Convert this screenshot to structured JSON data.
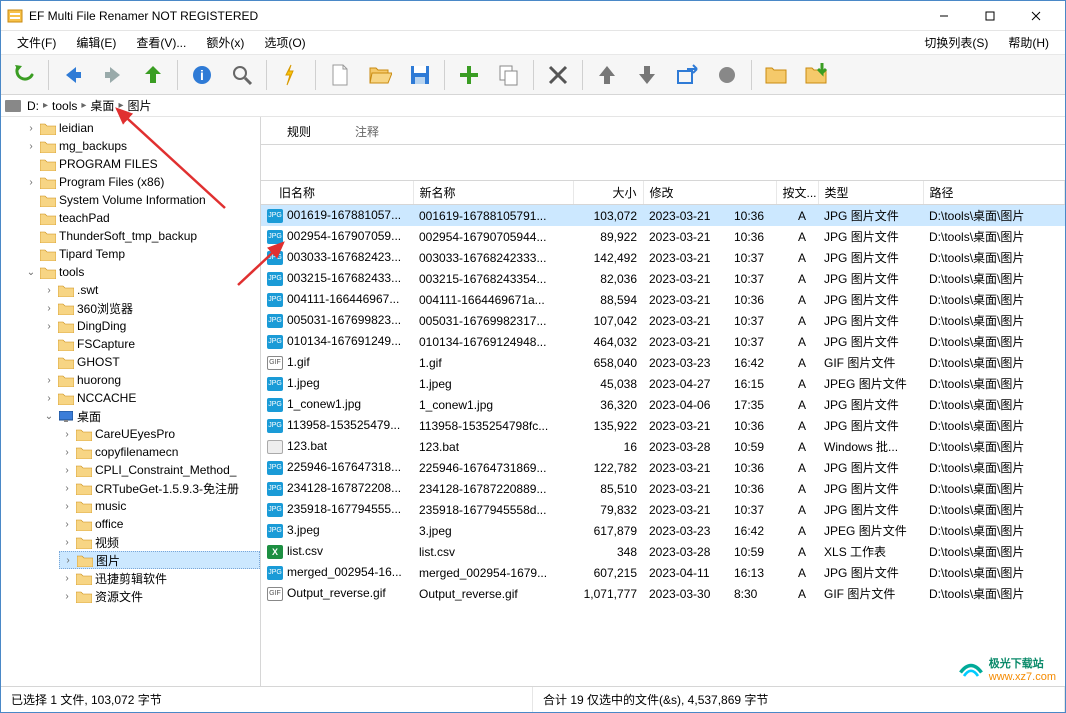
{
  "window": {
    "title": "EF Multi File Renamer NOT REGISTERED"
  },
  "menu": {
    "file": "文件(F)",
    "edit": "编辑(E)",
    "view": "查看(V)...",
    "extra": "额外(x)",
    "options": "选项(O)",
    "switch_list": "切换列表(S)",
    "help": "帮助(H)"
  },
  "breadcrumb": {
    "segs": [
      "D:",
      "tools",
      "桌面",
      "图片"
    ]
  },
  "tree": [
    {
      "l": "leidian",
      "d": 1,
      "e": "›"
    },
    {
      "l": "mg_backups",
      "d": 1,
      "e": "›"
    },
    {
      "l": "PROGRAM FILES",
      "d": 1,
      "e": ""
    },
    {
      "l": "Program Files (x86)",
      "d": 1,
      "e": "›"
    },
    {
      "l": "System Volume Information",
      "d": 1,
      "e": ""
    },
    {
      "l": "teachPad",
      "d": 1,
      "e": ""
    },
    {
      "l": "ThunderSoft_tmp_backup",
      "d": 1,
      "e": ""
    },
    {
      "l": "Tipard Temp",
      "d": 1,
      "e": ""
    },
    {
      "l": "tools",
      "d": 1,
      "e": "⌄"
    },
    {
      "l": ".swt",
      "d": 2,
      "e": "›"
    },
    {
      "l": "360浏览器",
      "d": 2,
      "e": "›"
    },
    {
      "l": "DingDing",
      "d": 2,
      "e": "›"
    },
    {
      "l": "FSCapture",
      "d": 2,
      "e": ""
    },
    {
      "l": "GHOST",
      "d": 2,
      "e": ""
    },
    {
      "l": "huorong",
      "d": 2,
      "e": "›"
    },
    {
      "l": "NCCACHE",
      "d": 2,
      "e": "›"
    },
    {
      "l": "桌面",
      "d": 2,
      "e": "⌄",
      "desk": true
    },
    {
      "l": "CareUEyesPro",
      "d": 3,
      "e": "›"
    },
    {
      "l": "copyfilenamecn",
      "d": 3,
      "e": "›"
    },
    {
      "l": "CPLI_Constraint_Method_",
      "d": 3,
      "e": "›"
    },
    {
      "l": "CRTubeGet-1.5.9.3-免注册",
      "d": 3,
      "e": "›"
    },
    {
      "l": "music",
      "d": 3,
      "e": "›"
    },
    {
      "l": "office",
      "d": 3,
      "e": "›"
    },
    {
      "l": "视频",
      "d": 3,
      "e": "›"
    },
    {
      "l": "图片",
      "d": 3,
      "e": "›",
      "sel": true
    },
    {
      "l": "迅捷剪辑软件",
      "d": 3,
      "e": "›"
    },
    {
      "l": "资源文件",
      "d": 3,
      "e": "›"
    }
  ],
  "tabs": {
    "rules": "规则",
    "comment": "注释"
  },
  "columns": {
    "old": "旧名称",
    "new": "新名称",
    "size": "大小",
    "mod": "修改",
    "attr": "按文...",
    "type": "类型",
    "path": "路径"
  },
  "rows": [
    {
      "old": "001619-167881057...",
      "new": "001619-16788105791...",
      "size": "103,072",
      "date": "2023-03-21",
      "time": "10:36",
      "attr": "A",
      "type": "JPG 图片文件",
      "path": "D:\\tools\\桌面\\图片",
      "ico": "jpg",
      "sel": true
    },
    {
      "old": "002954-167907059...",
      "new": "002954-16790705944...",
      "size": "89,922",
      "date": "2023-03-21",
      "time": "10:36",
      "attr": "A",
      "type": "JPG 图片文件",
      "path": "D:\\tools\\桌面\\图片",
      "ico": "jpg"
    },
    {
      "old": "003033-167682423...",
      "new": "003033-16768242333...",
      "size": "142,492",
      "date": "2023-03-21",
      "time": "10:37",
      "attr": "A",
      "type": "JPG 图片文件",
      "path": "D:\\tools\\桌面\\图片",
      "ico": "jpg"
    },
    {
      "old": "003215-167682433...",
      "new": "003215-16768243354...",
      "size": "82,036",
      "date": "2023-03-21",
      "time": "10:37",
      "attr": "A",
      "type": "JPG 图片文件",
      "path": "D:\\tools\\桌面\\图片",
      "ico": "jpg"
    },
    {
      "old": "004111-166446967...",
      "new": "004111-1664469671a...",
      "size": "88,594",
      "date": "2023-03-21",
      "time": "10:36",
      "attr": "A",
      "type": "JPG 图片文件",
      "path": "D:\\tools\\桌面\\图片",
      "ico": "jpg"
    },
    {
      "old": "005031-167699823...",
      "new": "005031-16769982317...",
      "size": "107,042",
      "date": "2023-03-21",
      "time": "10:37",
      "attr": "A",
      "type": "JPG 图片文件",
      "path": "D:\\tools\\桌面\\图片",
      "ico": "jpg"
    },
    {
      "old": "010134-167691249...",
      "new": "010134-16769124948...",
      "size": "464,032",
      "date": "2023-03-21",
      "time": "10:37",
      "attr": "A",
      "type": "JPG 图片文件",
      "path": "D:\\tools\\桌面\\图片",
      "ico": "jpg"
    },
    {
      "old": "1.gif",
      "new": "1.gif",
      "size": "658,040",
      "date": "2023-03-23",
      "time": "16:42",
      "attr": "A",
      "type": "GIF 图片文件",
      "path": "D:\\tools\\桌面\\图片",
      "ico": "gif"
    },
    {
      "old": "1.jpeg",
      "new": "1.jpeg",
      "size": "45,038",
      "date": "2023-04-27",
      "time": "16:15",
      "attr": "A",
      "type": "JPEG 图片文件",
      "path": "D:\\tools\\桌面\\图片",
      "ico": "jpeg"
    },
    {
      "old": "1_conew1.jpg",
      "new": "1_conew1.jpg",
      "size": "36,320",
      "date": "2023-04-06",
      "time": "17:35",
      "attr": "A",
      "type": "JPG 图片文件",
      "path": "D:\\tools\\桌面\\图片",
      "ico": "jpg"
    },
    {
      "old": "113958-153525479...",
      "new": "113958-1535254798fc...",
      "size": "135,922",
      "date": "2023-03-21",
      "time": "10:36",
      "attr": "A",
      "type": "JPG 图片文件",
      "path": "D:\\tools\\桌面\\图片",
      "ico": "jpg"
    },
    {
      "old": "123.bat",
      "new": "123.bat",
      "size": "16",
      "date": "2023-03-28",
      "time": "10:59",
      "attr": "A",
      "type": "Windows 批...",
      "path": "D:\\tools\\桌面\\图片",
      "ico": "bat"
    },
    {
      "old": "225946-167647318...",
      "new": "225946-16764731869...",
      "size": "122,782",
      "date": "2023-03-21",
      "time": "10:36",
      "attr": "A",
      "type": "JPG 图片文件",
      "path": "D:\\tools\\桌面\\图片",
      "ico": "jpg"
    },
    {
      "old": "234128-167872208...",
      "new": "234128-16787220889...",
      "size": "85,510",
      "date": "2023-03-21",
      "time": "10:36",
      "attr": "A",
      "type": "JPG 图片文件",
      "path": "D:\\tools\\桌面\\图片",
      "ico": "jpg"
    },
    {
      "old": "235918-167794555...",
      "new": "235918-1677945558d...",
      "size": "79,832",
      "date": "2023-03-21",
      "time": "10:37",
      "attr": "A",
      "type": "JPG 图片文件",
      "path": "D:\\tools\\桌面\\图片",
      "ico": "jpg"
    },
    {
      "old": "3.jpeg",
      "new": "3.jpeg",
      "size": "617,879",
      "date": "2023-03-23",
      "time": "16:42",
      "attr": "A",
      "type": "JPEG 图片文件",
      "path": "D:\\tools\\桌面\\图片",
      "ico": "jpeg"
    },
    {
      "old": "list.csv",
      "new": "list.csv",
      "size": "348",
      "date": "2023-03-28",
      "time": "10:59",
      "attr": "A",
      "type": "XLS 工作表",
      "path": "D:\\tools\\桌面\\图片",
      "ico": "xls"
    },
    {
      "old": "merged_002954-16...",
      "new": "merged_002954-1679...",
      "size": "607,215",
      "date": "2023-04-11",
      "time": "16:13",
      "attr": "A",
      "type": "JPG 图片文件",
      "path": "D:\\tools\\桌面\\图片",
      "ico": "jpg"
    },
    {
      "old": "Output_reverse.gif",
      "new": "Output_reverse.gif",
      "size": "1,071,777",
      "date": "2023-03-30",
      "time": "8:30",
      "attr": "A",
      "type": "GIF 图片文件",
      "path": "D:\\tools\\桌面\\图片",
      "ico": "gif"
    }
  ],
  "status": {
    "left": "已选择 1 文件, 103,072 字节",
    "right": "合计 19 仅选中的文件(&s), 4,537,869 字节"
  },
  "watermark": {
    "name": "极光下载站",
    "url": "www.xz7.com"
  }
}
